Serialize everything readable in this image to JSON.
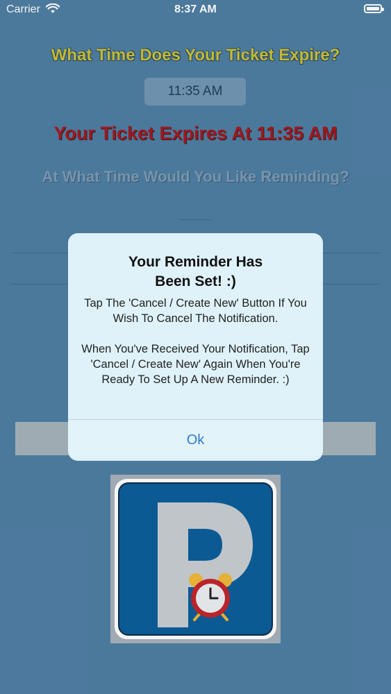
{
  "status_bar": {
    "carrier": "Carrier",
    "time": "8:37 AM"
  },
  "main": {
    "expire_question": "What Time Does Your Ticket Expire?",
    "time_value": "11:35 AM",
    "expires_at": "Your Ticket Expires At 11:35 AM",
    "remind_question": "At What Time Would You Like Reminding?"
  },
  "alert": {
    "title_line1": "Your Reminder Has",
    "title_line2": "Been Set! :)",
    "message": "Tap The 'Cancel / Create New' Button If You Wish To Cancel The Notification.\n\nWhen You've Received Your Notification, Tap 'Cancel / Create New' Again When You're Ready To Set Up A New Reminder. :)",
    "ok_label": "Ok"
  },
  "icons": {
    "wifi": "wifi-icon",
    "battery": "battery-icon",
    "parking_sign": "parking-sign-icon",
    "alarm_clock": "alarm-clock-icon"
  },
  "colors": {
    "background": "#4f7ea3",
    "question_yellow": "#c9c13a",
    "expires_red": "#a51a22",
    "alert_button_blue": "#2f7ad0",
    "sign_blue": "#0c5e99",
    "clock_red": "#c1272d",
    "clock_bell_gold": "#f0b93b"
  }
}
